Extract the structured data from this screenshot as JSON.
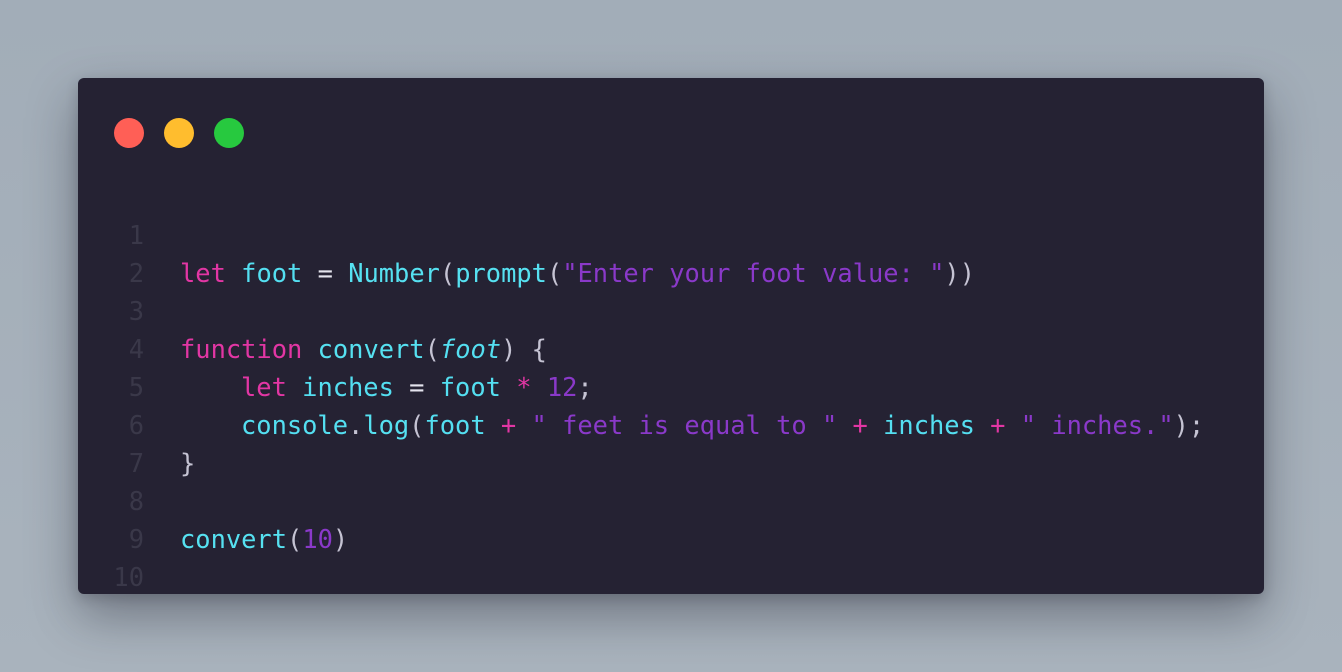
{
  "window": {
    "controls": [
      {
        "name": "close",
        "color": "#ff5f56"
      },
      {
        "name": "minimize",
        "color": "#ffbd2e"
      },
      {
        "name": "maximize",
        "color": "#27c93f"
      }
    ]
  },
  "editor": {
    "lines": [
      {
        "n": "1",
        "t": [
          "let",
          " ",
          "foot",
          " ",
          "=",
          " ",
          "Number",
          "(",
          "prompt",
          "(",
          "\"Enter your foot value: \"",
          "))"
        ]
      },
      {
        "n": "2",
        "t": []
      },
      {
        "n": "3",
        "t": [
          "function",
          " ",
          "convert",
          "(",
          "foot",
          ") {"
        ]
      },
      {
        "n": "4",
        "t": [
          "let",
          " ",
          "inches",
          " ",
          "=",
          " ",
          "foot",
          " ",
          "*",
          " ",
          "12",
          ";"
        ]
      },
      {
        "n": "5",
        "t": [
          "console",
          ".",
          "log",
          "(",
          "foot",
          " ",
          "+",
          " ",
          "\" feet is equal to \"",
          " ",
          "+",
          " ",
          "inches",
          " ",
          "+",
          " ",
          "\" inches.\"",
          ");"
        ]
      },
      {
        "n": "6",
        "t": [
          "}"
        ]
      },
      {
        "n": "7",
        "t": []
      },
      {
        "n": "8",
        "t": [
          "convert",
          "(",
          "10",
          ")"
        ]
      },
      {
        "n": "9",
        "t": []
      },
      {
        "n": "10",
        "t": []
      }
    ]
  },
  "colors": {
    "background": "#a6b0bb",
    "editor_background": "#252233",
    "keyword": "#e236a4",
    "identifier": "#54dff1",
    "string": "#8a39c9",
    "punctuation": "#c5c3d3",
    "line_number": "#3a3849"
  }
}
